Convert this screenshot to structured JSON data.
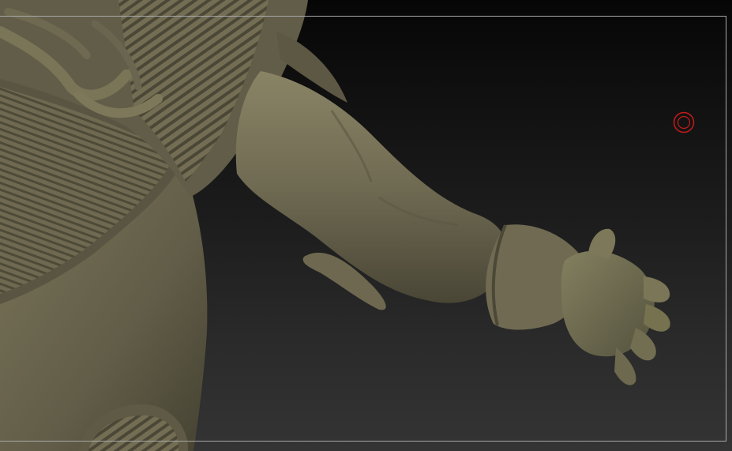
{
  "viewport": {
    "background_top": "#060606",
    "background_bottom": "#343434",
    "frame_color": "#a8a8a8"
  },
  "model": {
    "icon": "sculpt-mesh",
    "material_base": "#6b6650",
    "material_highlight": "#8c8668",
    "material_shadow": "#3d3a2c"
  },
  "cursor": {
    "icon": "brush-cursor-icon",
    "color": "#c41a1a"
  }
}
